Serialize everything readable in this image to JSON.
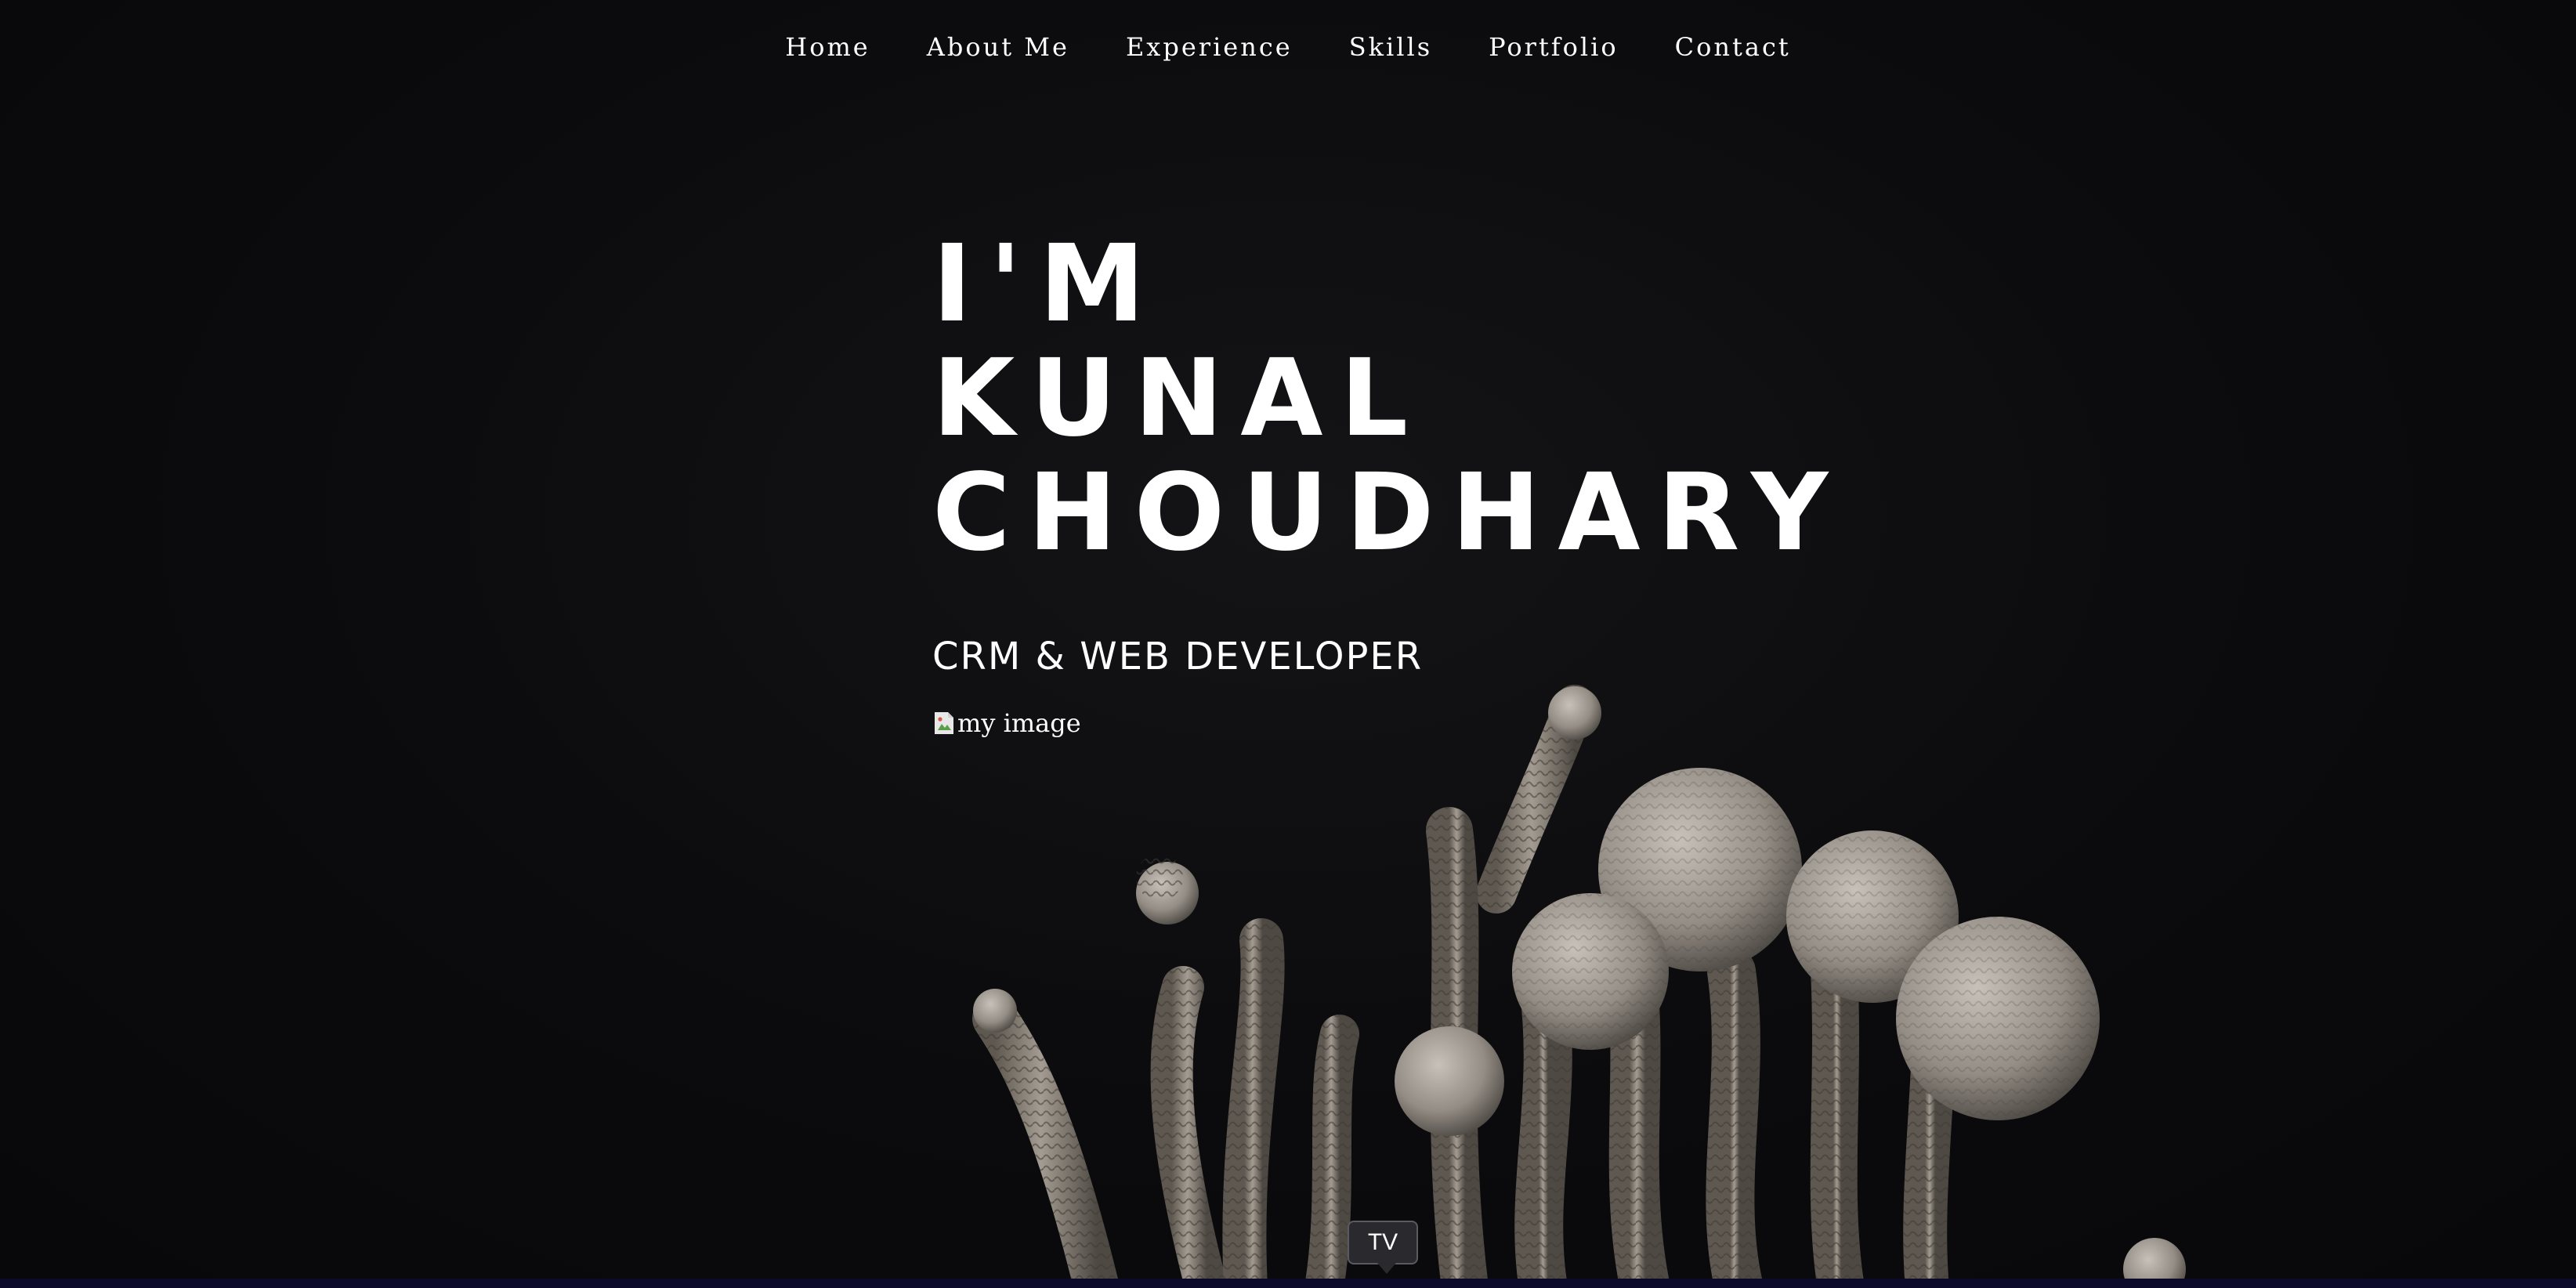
{
  "nav": {
    "items": [
      {
        "label": "Home"
      },
      {
        "label": "About Me"
      },
      {
        "label": "Experience"
      },
      {
        "label": "Skills"
      },
      {
        "label": "Portfolio"
      },
      {
        "label": "Contact"
      }
    ]
  },
  "hero": {
    "title_lines": [
      "I'M",
      "KUNAL",
      "CHOUDHARY"
    ],
    "subtitle": "CRM & WEB DEVELOPER",
    "image_alt": "my image"
  },
  "tooltip": {
    "text": "TV"
  },
  "colors": {
    "background": "#0b0b0d",
    "text": "#ffffff",
    "plant": "#9a938b"
  }
}
